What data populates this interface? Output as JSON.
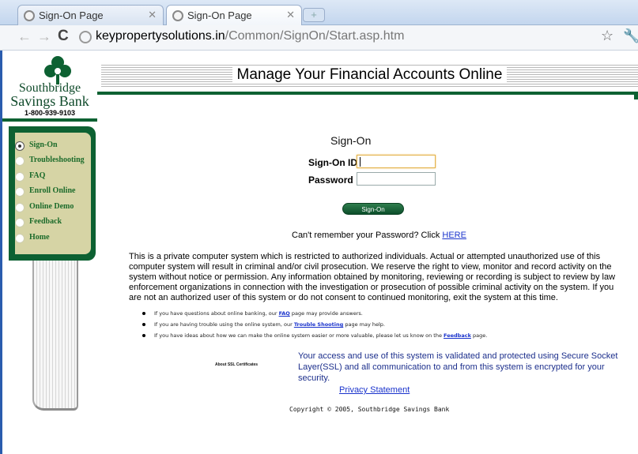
{
  "browser": {
    "tabs": [
      {
        "title": "Sign-On Page",
        "active": false
      },
      {
        "title": "Sign-On Page",
        "active": true
      }
    ],
    "url_domain": "keypropertysolutions.in",
    "url_path": "/Common/SignOn/Start.asp.htm"
  },
  "bank": {
    "name_line1": "Southbridge",
    "name_line2": "Savings Bank",
    "phone": "1-800-939-9103",
    "brand_color": "#0d6132"
  },
  "header": {
    "title": "Manage Your Financial Accounts Online"
  },
  "menu": {
    "items": [
      {
        "label": "Sign-On",
        "selected": true
      },
      {
        "label": "Troubleshooting",
        "selected": false
      },
      {
        "label": "FAQ",
        "selected": false
      },
      {
        "label": "Enroll Online",
        "selected": false
      },
      {
        "label": "Online Demo",
        "selected": false
      },
      {
        "label": "Feedback",
        "selected": false
      },
      {
        "label": "Home",
        "selected": false
      }
    ]
  },
  "form": {
    "title": "Sign-On",
    "id_label": "Sign-On ID",
    "id_value": "",
    "password_label": "Password",
    "password_value": "",
    "submit_label": "Sign-On",
    "forgot_text": "Can't remember your Password? Click ",
    "forgot_link": "HERE"
  },
  "legal": {
    "text": "This is a private computer system which is restricted to authorized individuals.  Actual or attempted unauthorized use of this computer system will result in criminal and/or civil prosecution.  We reserve the right to view, monitor and record activity on the system without notice or permission.  Any information obtained by monitoring, reviewing or recording is subject to review by law enforcement organizations in connection with the investigation or prosecution of possible criminal activity on the system.  If you are not an authorized user of this system or do not consent to continued monitoring, exit the system at this time."
  },
  "bullets": [
    {
      "pre": "If you have questions about online banking, our ",
      "link": "FAQ",
      "post": " page may provide answers."
    },
    {
      "pre": "If you are having trouble using the online system, our ",
      "link": "Trouble Shooting",
      "post": " page may help."
    },
    {
      "pre": "If you have ideas about how we can make the online system easier or more valuable, please let us know on the ",
      "link": "Feedback",
      "post": " page."
    }
  ],
  "footer": {
    "ssl_label": "About SSL Certificates",
    "ssl_text": "Your access and use of this system is validated and protected using Secure Socket Layer(SSL) and all communication to and from this system is encrypted for your security.",
    "privacy": "Privacy Statement",
    "copyright": "Copyright © 2005, Southbridge Savings Bank"
  }
}
